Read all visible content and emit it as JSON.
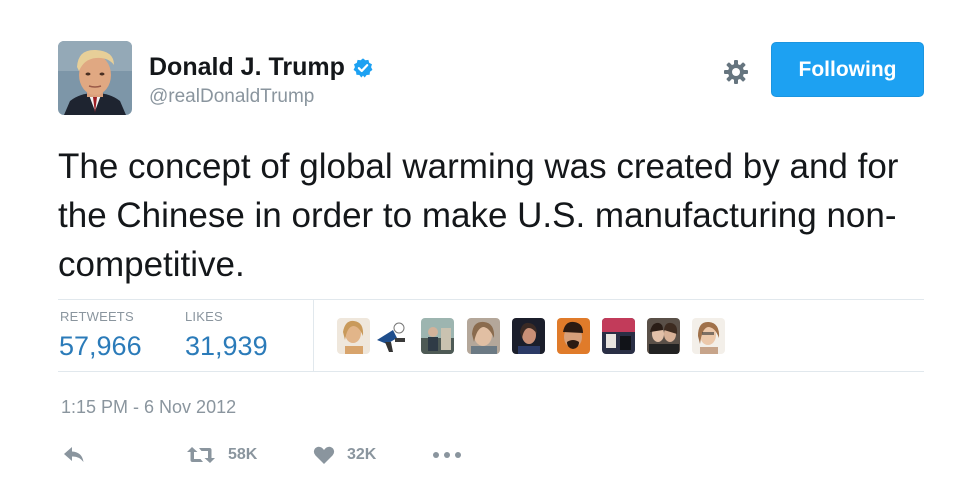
{
  "tweet": {
    "author_name": "Donald J. Trump",
    "handle": "@realDonaldTrump",
    "verified": true,
    "follow_label": "Following",
    "text": "The concept of global warming was created by and for the Chinese in order to make U.S. manufacturing non-competitive.",
    "timestamp": "1:15 PM - 6 Nov 2012"
  },
  "stats": {
    "retweets_label": "RETWEETS",
    "retweets_value": "57,966",
    "likes_label": "LIKES",
    "likes_value": "31,939"
  },
  "actions": {
    "retweet_count": "58K",
    "like_count": "32K"
  },
  "colors": {
    "accent": "#1da1f2",
    "stat_value": "#2b7bb9",
    "muted": "#8a959e"
  },
  "icons": [
    "verified-badge-icon",
    "gear-icon",
    "reply-icon",
    "retweet-icon",
    "heart-icon",
    "more-icon"
  ]
}
